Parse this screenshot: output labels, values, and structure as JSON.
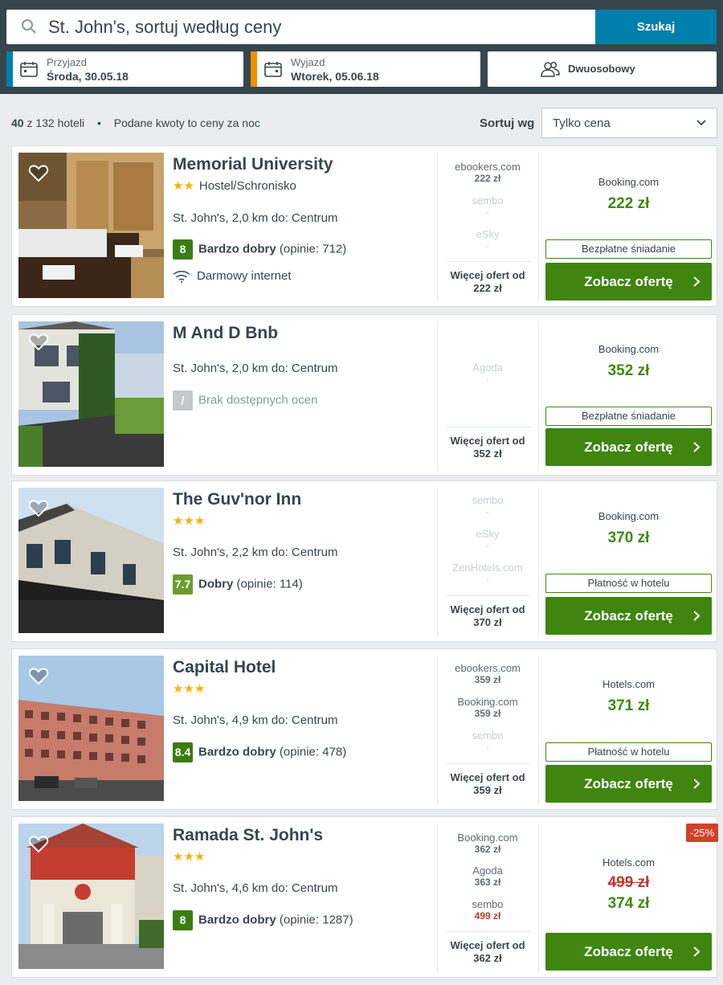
{
  "search": {
    "query": "St. John's, sortuj według ceny",
    "button_label": "Szukaj"
  },
  "dates": {
    "checkin_label": "Przyjazd",
    "checkin_value": "Środa, 30.05.18",
    "checkin_color": "#007fad",
    "checkout_label": "Wyjazd",
    "checkout_value": "Wtorek, 05.06.18",
    "checkout_color": "#f48f00"
  },
  "room": {
    "label": "Dwuosobowy"
  },
  "results": {
    "count_bold": "40",
    "count_rest": "z 132 hoteli",
    "note": "Podane kwoty to ceny za noc"
  },
  "sort": {
    "label": "Sortuj wg",
    "selected": "Tylko cena"
  },
  "colors": {
    "accent": "#007fad",
    "cta_green": "#3f8510",
    "price_green": "#3d8a0e",
    "discount_red": "#d0412a"
  },
  "hotels": [
    {
      "name": "Memorial University",
      "stars": "★★",
      "type": "Hostel/Schronisko",
      "location": "St. John's, 2,0 km do: Centrum",
      "rating": "8",
      "rating_word": "Bardzo dobry",
      "reviews": "(opinie: 712)",
      "amenity": "Darmowy internet",
      "deals": [
        {
          "site": "ebookers.com",
          "price": "222 zł"
        },
        {
          "site": "sembo",
          "price": "-"
        },
        {
          "site": "eSky",
          "price": "-"
        }
      ],
      "more_label": "Więcej ofert od",
      "more_price": "222 zł",
      "provider": "Booking.com",
      "price": "222 zł",
      "tag": "Bezpłatne śniadanie",
      "cta": "Zobacz ofertę"
    },
    {
      "name": "M And D Bnb",
      "location": "St. John's, 2,0 km do: Centrum",
      "rating": "/",
      "rating_word": "Brak dostępnych ocen",
      "deals": [
        {
          "site": "Agoda",
          "price": "-"
        }
      ],
      "more_label": "Więcej ofert od",
      "more_price": "352 zł",
      "provider": "Booking.com",
      "price": "352 zł",
      "tag": "Bezpłatne śniadanie",
      "cta": "Zobacz ofertę"
    },
    {
      "name": "The Guv'nor Inn",
      "stars": "★★★",
      "location": "St. John's, 2,2 km do: Centrum",
      "rating": "7.7",
      "rating_word": "Dobry",
      "reviews": "(opinie: 114)",
      "deals": [
        {
          "site": "sembo",
          "price": "-"
        },
        {
          "site": "eSky",
          "price": "-"
        },
        {
          "site": "ZenHotels.com",
          "price": "-"
        }
      ],
      "more_label": "Więcej ofert od",
      "more_price": "370 zł",
      "provider": "Booking.com",
      "price": "370 zł",
      "tag": "Płatność w hotelu",
      "cta": "Zobacz ofertę"
    },
    {
      "name": "Capital Hotel",
      "stars": "★★★",
      "location": "St. John's, 4,9 km do: Centrum",
      "rating": "8.4",
      "rating_word": "Bardzo dobry",
      "reviews": "(opinie: 478)",
      "deals": [
        {
          "site": "ebookers.com",
          "price": "359 zł"
        },
        {
          "site": "Booking.com",
          "price": "359 zł"
        },
        {
          "site": "sembo",
          "price": "-"
        }
      ],
      "more_label": "Więcej ofert od",
      "more_price": "359 zł",
      "provider": "Hotels.com",
      "price": "371 zł",
      "tag": "Płatność w hotelu",
      "cta": "Zobacz ofertę"
    },
    {
      "name": "Ramada St. John's",
      "stars": "★★★",
      "location": "St. John's, 4,6 km do: Centrum",
      "rating": "8",
      "rating_word": "Bardzo dobry",
      "reviews": "(opinie: 1287)",
      "deals": [
        {
          "site": "Booking.com",
          "price": "362 zł"
        },
        {
          "site": "Agoda",
          "price": "363 zł"
        },
        {
          "site": "sembo",
          "price": "499 zł"
        }
      ],
      "more_label": "Więcej ofert od",
      "more_price": "362 zł",
      "provider": "Hotels.com",
      "old_price": "499 zł",
      "price": "374 zł",
      "discount": "-25%",
      "cta": "Zobacz ofertę"
    }
  ]
}
